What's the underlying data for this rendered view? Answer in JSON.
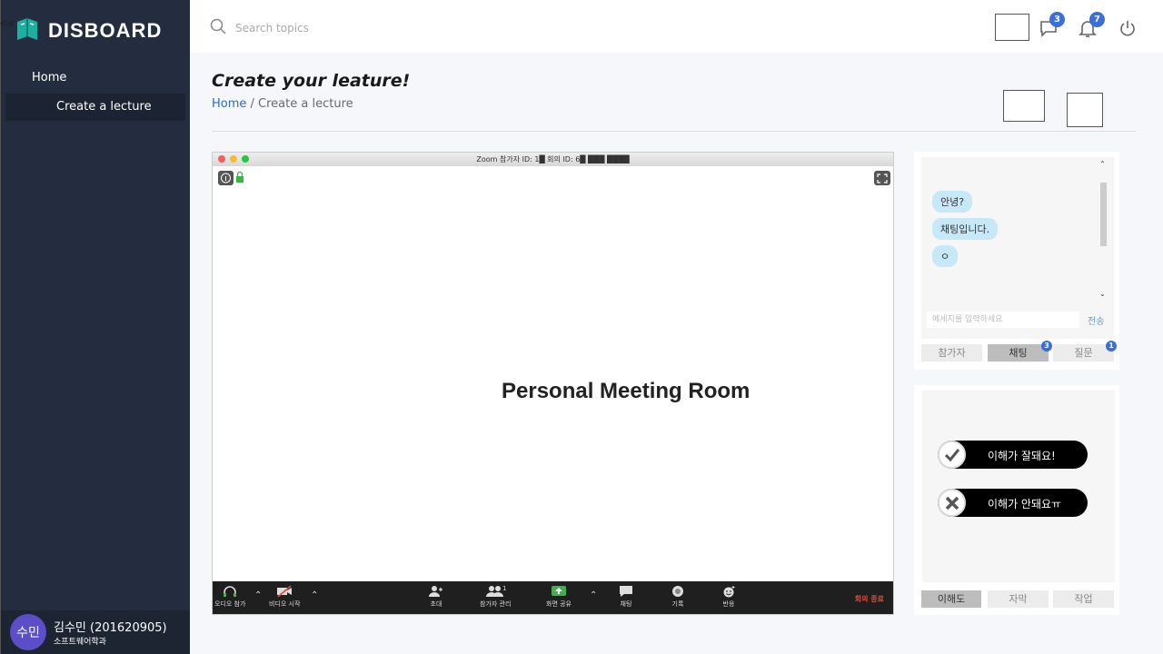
{
  "sidebar": {
    "toggle": "<<",
    "logo_text": "DISBOARD",
    "nav": {
      "home": "Home",
      "create": "Create a lecture"
    },
    "profile": {
      "avatar": "수민",
      "name": "김수민 (201620905)",
      "dept": "소프트웨어학과"
    }
  },
  "topbar": {
    "search_placeholder": "Search topics",
    "chat_badge": "3",
    "notif_badge": "7"
  },
  "header": {
    "title": "Create your leature!",
    "breadcrumb_home": "Home",
    "breadcrumb_sep": " / ",
    "breadcrumb_current": "Create a lecture"
  },
  "zoom": {
    "window_title": "Zoom 참가자 ID: 1█      회의 ID: 6█ ███ ████",
    "room_name": "Personal Meeting Room",
    "toolbar": {
      "audio": "오디오 참가",
      "video": "비디오 시작",
      "invite": "초대",
      "participants": "참가자 관리",
      "participant_count": "1",
      "share": "화면 공유",
      "chat": "채팅",
      "record": "기록",
      "reaction": "반응",
      "end": "회의 종료"
    }
  },
  "chat": {
    "messages": [
      "안녕?",
      "채팅입니다.",
      "ㅇ"
    ],
    "input_placeholder": "메세지를 입력하세요",
    "send": "전송",
    "tabs": [
      "참가자",
      "채팅",
      "질문"
    ],
    "chat_badge": "3",
    "question_badge": "1"
  },
  "understanding": {
    "good": "이해가 잘돼요!",
    "bad": "이해가 안돼요ㅠ",
    "tabs": [
      "이해도",
      "자막",
      "작업"
    ]
  },
  "colors": {
    "sidebar": "#232d3f",
    "accent": "#3a6fd8",
    "bubble": "#c7e8f7"
  }
}
